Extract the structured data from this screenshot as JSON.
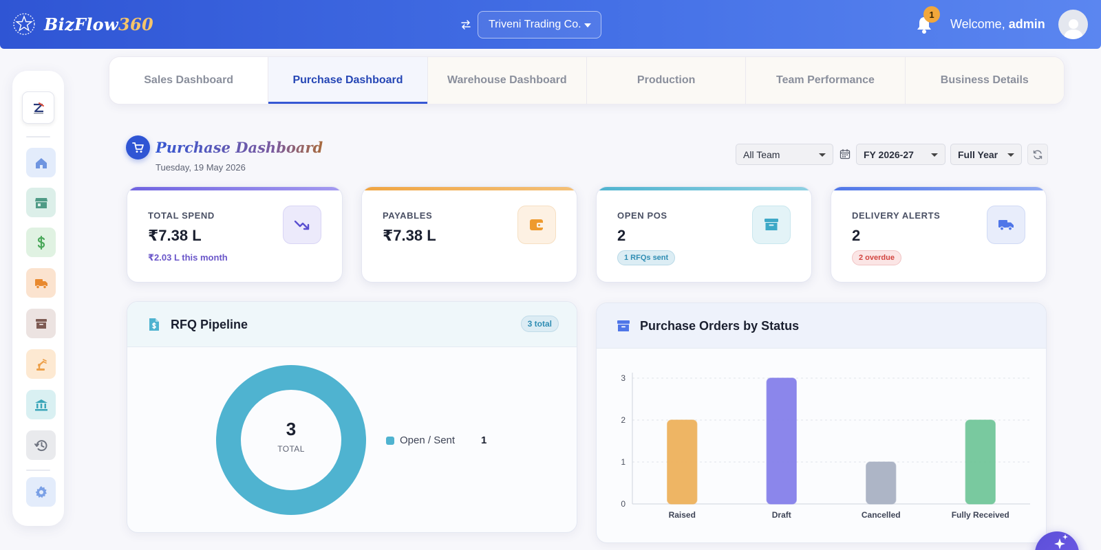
{
  "header": {
    "brand_main": "BizFlow",
    "brand_accent": "360",
    "company": "Triveni Trading Co.",
    "notification_count": "1",
    "welcome_prefix": "Welcome,",
    "username": "admin"
  },
  "sidebar": {
    "items": [
      {
        "icon": "home-icon",
        "bg": "#e3ecfb",
        "color": "#6f95e0"
      },
      {
        "icon": "store-icon",
        "bg": "#dcefe9",
        "color": "#4f9b86"
      },
      {
        "icon": "dollar-icon",
        "bg": "#e0f2e2",
        "color": "#4aa85a"
      },
      {
        "icon": "truck-icon",
        "bg": "#fbe3cf",
        "color": "#e8892f"
      },
      {
        "icon": "archive-icon",
        "bg": "#ece3e1",
        "color": "#7d5a52"
      },
      {
        "icon": "robot-arm-icon",
        "bg": "#fde9d2",
        "color": "#eda04a"
      },
      {
        "icon": "bank-icon",
        "bg": "#d9f0f2",
        "color": "#3aa6b9"
      },
      {
        "icon": "history-icon",
        "bg": "#e9eaed",
        "color": "#6f7480"
      },
      {
        "icon": "gear-icon",
        "bg": "#e3ecfb",
        "color": "#7aa0e6"
      }
    ]
  },
  "tabs": [
    {
      "label": "Sales Dashboard",
      "active": false
    },
    {
      "label": "Purchase Dashboard",
      "active": true
    },
    {
      "label": "Warehouse Dashboard",
      "active": false
    },
    {
      "label": "Production",
      "active": false
    },
    {
      "label": "Team Performance",
      "active": false
    },
    {
      "label": "Business Details",
      "active": false
    }
  ],
  "page": {
    "title": "Purchase Dashboard",
    "date": "Tuesday, 19 May 2026"
  },
  "filters": {
    "team": "All Team",
    "fy": "FY 2026-27",
    "period": "Full Year"
  },
  "kpis": [
    {
      "label": "TOTAL SPEND",
      "value": "₹7.38 L",
      "sub": "₹2.03 L this month",
      "accent": "#6f62e0",
      "icon": "trending-down-icon"
    },
    {
      "label": "PAYABLES",
      "value": "₹7.38 L",
      "accent": "#f0a441",
      "icon": "wallet-icon"
    },
    {
      "label": "OPEN POS",
      "value": "2",
      "pill": "1 RFQs sent",
      "accent": "#4fb3cf",
      "icon": "archive-icon"
    },
    {
      "label": "DELIVERY ALERTS",
      "value": "2",
      "pill": "2 overdue",
      "accent": "#4f76e8",
      "icon": "truck-icon"
    }
  ],
  "rfq": {
    "title": "RFQ Pipeline",
    "badge": "3 total",
    "total": "3",
    "total_label": "TOTAL",
    "legend": [
      {
        "label": "Open / Sent",
        "value": "1",
        "color": "#4fb3d0"
      }
    ]
  },
  "po_chart": {
    "title": "Purchase Orders by Status"
  },
  "chart_data": {
    "type": "bar",
    "title": "Purchase Orders by Status",
    "categories": [
      "Raised",
      "Draft",
      "Cancelled",
      "Fully Received"
    ],
    "values": [
      2,
      3,
      1,
      2
    ],
    "colors": [
      "#edb15c",
      "#8580ea",
      "#a9b1c3",
      "#72c69a"
    ],
    "yticks": [
      0,
      1,
      2,
      3
    ],
    "ylim": [
      0,
      3
    ],
    "grid": true
  }
}
